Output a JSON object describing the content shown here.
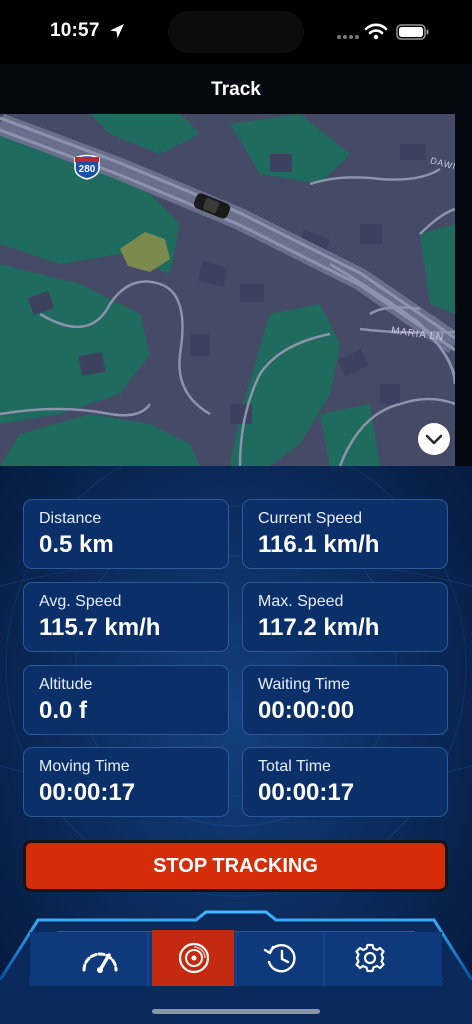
{
  "status_bar": {
    "time": "10:57"
  },
  "nav": {
    "title": "Track"
  },
  "map": {
    "highway_shield": "280",
    "street_labels": [
      "DAWN",
      "MARIA LN"
    ]
  },
  "stats": [
    {
      "label": "Distance",
      "value": "0.5 km"
    },
    {
      "label": "Current Speed",
      "value": "116.1 km/h"
    },
    {
      "label": "Avg. Speed",
      "value": "115.7 km/h"
    },
    {
      "label": "Max. Speed",
      "value": "117.2 km/h"
    },
    {
      "label": "Altitude",
      "value": "0.0 f"
    },
    {
      "label": "Waiting Time",
      "value": "00:00:00"
    },
    {
      "label": "Moving Time",
      "value": "00:00:17"
    },
    {
      "label": "Total Time",
      "value": "00:00:17"
    }
  ],
  "stop_button": {
    "label": "STOP TRACKING"
  },
  "tabs": [
    {
      "icon": "speedometer-icon",
      "selected": false
    },
    {
      "icon": "record-disc-icon",
      "selected": true
    },
    {
      "icon": "history-clock-icon",
      "selected": false
    },
    {
      "icon": "gear-icon",
      "selected": false
    }
  ],
  "colors": {
    "accent_red": "#d52d0a",
    "card_bg": "#0b2f68",
    "dashboard_bg": "#0b2a5a",
    "tab_active": "#c42a10",
    "map_land": "#454a66",
    "map_park": "#1f6b5e"
  }
}
